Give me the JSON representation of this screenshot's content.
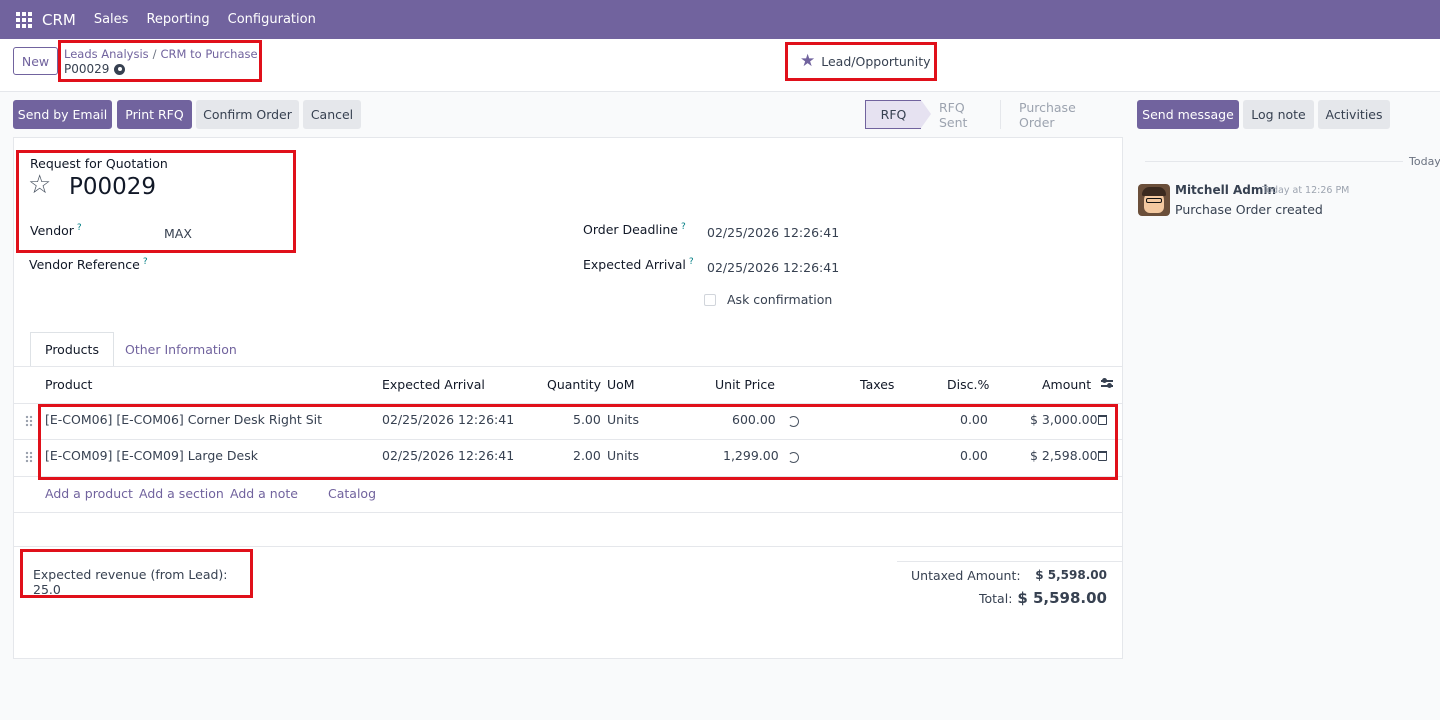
{
  "topnav": {
    "brand": "CRM",
    "menu": [
      "Sales",
      "Reporting",
      "Configuration"
    ]
  },
  "control": {
    "new_label": "New",
    "breadcrumb": [
      "Leads Analysis",
      "CRM to Purchase"
    ],
    "breadcrumb_separator": "/",
    "current_record": "P00029",
    "smart_button": "Lead/Opportunity"
  },
  "actions": {
    "send_email": "Send by Email",
    "print_rfq": "Print RFQ",
    "confirm": "Confirm Order",
    "cancel": "Cancel"
  },
  "status": {
    "stages": [
      "RFQ",
      "RFQ Sent",
      "Purchase Order"
    ],
    "active": "RFQ"
  },
  "form": {
    "doc_type": "Request for Quotation",
    "name": "P00029",
    "vendor_label": "Vendor",
    "vendor_value": "MAX",
    "vendor_ref_label": "Vendor Reference",
    "order_deadline_label": "Order Deadline",
    "order_deadline_value": "02/25/2026 12:26:41",
    "expected_arrival_label": "Expected Arrival",
    "expected_arrival_value": "02/25/2026 12:26:41",
    "ask_confirmation_label": "Ask confirmation",
    "help_mark": "?"
  },
  "tabs": [
    "Products",
    "Other Information"
  ],
  "table": {
    "headers": {
      "product": "Product",
      "expected_arrival": "Expected Arrival",
      "quantity": "Quantity",
      "uom": "UoM",
      "unit_price": "Unit Price",
      "taxes": "Taxes",
      "discount": "Disc.%",
      "amount": "Amount"
    },
    "rows": [
      {
        "product": "[E-COM06] [E-COM06] Corner Desk Right Sit",
        "expected_arrival": "02/25/2026 12:26:41",
        "quantity": "5.00",
        "uom": "Units",
        "unit_price": "600.00",
        "discount": "0.00",
        "amount": "$ 3,000.00"
      },
      {
        "product": "[E-COM09] [E-COM09] Large Desk",
        "expected_arrival": "02/25/2026 12:26:41",
        "quantity": "2.00",
        "uom": "Units",
        "unit_price": "1,299.00",
        "discount": "0.00",
        "amount": "$ 2,598.00"
      }
    ],
    "add_links": [
      "Add a product",
      "Add a section",
      "Add a note",
      "Catalog"
    ]
  },
  "footer": {
    "expected_revenue": "Expected revenue (from Lead): 25.0",
    "untaxed_label": "Untaxed Amount:",
    "untaxed_value": "$ 5,598.00",
    "total_label": "Total:",
    "total_value": "$ 5,598.00"
  },
  "chatter": {
    "send_message": "Send message",
    "log_note": "Log note",
    "activities": "Activities",
    "day_separator": "Today",
    "message": {
      "author": "Mitchell Admin",
      "date": "Today at 12:26 PM",
      "body": "Purchase Order created"
    }
  },
  "colors": {
    "brand": "#71639e",
    "highlight": "#e0101a",
    "help": "#017e84"
  }
}
